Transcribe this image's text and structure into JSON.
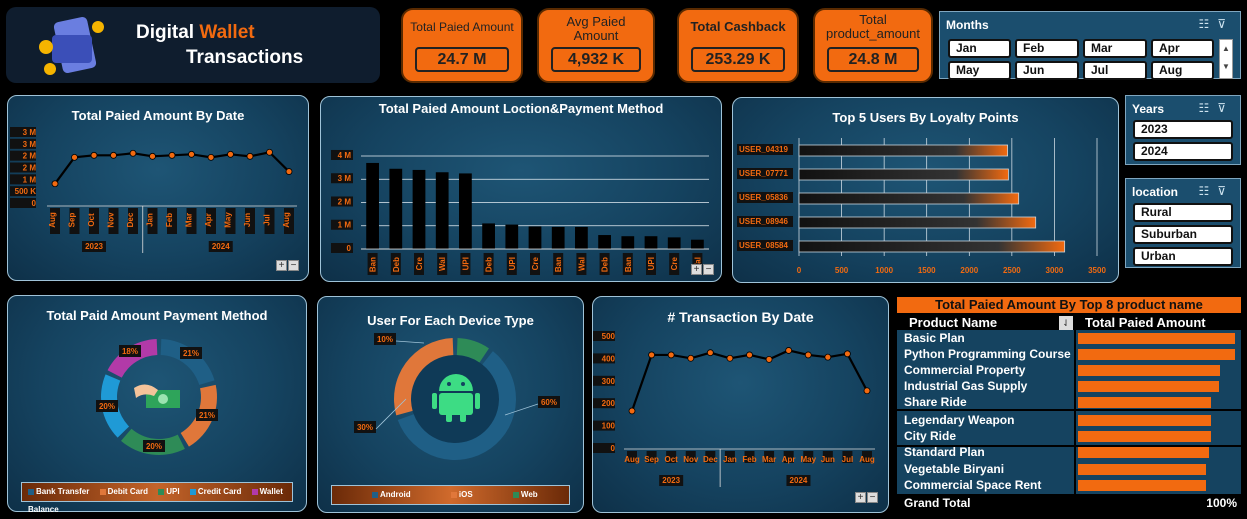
{
  "header": {
    "title_line1": "Digital",
    "title_accent": "Wallet",
    "title_line2": "Transactions"
  },
  "kpis": [
    {
      "label": "Total Paied Amount",
      "value": "24.7  M"
    },
    {
      "label": "Avg Paied Amount",
      "value": "4,932 K"
    },
    {
      "label": "Total Cashback",
      "value": "253.29 K"
    },
    {
      "label": "Total product_amount",
      "value": "24.8  M"
    }
  ],
  "slicers": {
    "months": {
      "title": "Months",
      "items": [
        "Jan",
        "Feb",
        "Mar",
        "Apr",
        "May",
        "Jun",
        "Jul",
        "Aug"
      ]
    },
    "years": {
      "title": "Years",
      "items": [
        "2023",
        "2024"
      ]
    },
    "location": {
      "title": "location",
      "items": [
        "Rural",
        "Suburban",
        "Urban"
      ]
    }
  },
  "colors": {
    "accent": "#f26a10",
    "panel": "#154360",
    "bank": "#1f5f86",
    "debit": "#e0773a",
    "upi": "#2e8b57",
    "credit": "#1f9ad6",
    "wallet": "#b23aa8"
  },
  "chart_data": [
    {
      "type": "line",
      "title": "Total Paied Amount By Date",
      "x": [
        "Aug",
        "Sep",
        "Oct",
        "Nov",
        "Dec",
        "Jan",
        "Feb",
        "Mar",
        "Apr",
        "May",
        "Jun",
        "Jul",
        "Aug"
      ],
      "groups": [
        {
          "label": "2023",
          "span": 5
        },
        {
          "label": "2024",
          "span": 8
        }
      ],
      "y_ticks": [
        "0",
        "500 K",
        "1 M",
        "2 M",
        "2 M",
        "3 M",
        "3 M"
      ],
      "values": [
        1.0,
        2.3,
        2.4,
        2.4,
        2.5,
        2.35,
        2.4,
        2.45,
        2.3,
        2.45,
        2.35,
        2.55,
        1.6
      ],
      "ylim": [
        0,
        3.5
      ]
    },
    {
      "type": "bar",
      "title": "Total Paied Amount Loction&Payment Method",
      "categories": [
        "Ban",
        "Deb",
        "Cre",
        "Wal",
        "UPI",
        "Deb",
        "UPI",
        "Cre",
        "Ban",
        "Wal",
        "Deb",
        "Ban",
        "UPI",
        "Cre",
        "Wal"
      ],
      "values": [
        3.7,
        3.45,
        3.4,
        3.3,
        3.25,
        1.1,
        1.05,
        0.97,
        0.95,
        0.95,
        0.6,
        0.55,
        0.55,
        0.5,
        0.4
      ],
      "y_ticks": [
        "0",
        "1 M",
        "2 M",
        "3 M",
        "4 M"
      ],
      "ylim": [
        0,
        4.3
      ]
    },
    {
      "type": "bar",
      "title": "Top 5 Users By Loyalty Points",
      "categories": [
        "USER_04319",
        "USER_07771",
        "USER_05836",
        "USER_08946",
        "USER_08584"
      ],
      "values": [
        2450,
        2460,
        2580,
        2780,
        3120
      ],
      "x_ticks": [
        "0",
        "500",
        "1000",
        "1500",
        "2000",
        "2500",
        "3000",
        "3500"
      ],
      "xlim": [
        0,
        3500
      ]
    },
    {
      "type": "pie",
      "title": "Total Paid Amount Payment Method",
      "slices": [
        {
          "name": "Bank Transfer",
          "value": 21,
          "label": "21%"
        },
        {
          "name": "Debit Card",
          "value": 21,
          "label": "21%"
        },
        {
          "name": "UPI",
          "value": 20,
          "label": "20%"
        },
        {
          "name": "Credit Card",
          "value": 20,
          "label": "20%"
        },
        {
          "name": "Wallet Balance",
          "value": 18,
          "label": "18%"
        }
      ]
    },
    {
      "type": "pie",
      "title": "User  For Each Device Type",
      "slices": [
        {
          "name": "Android",
          "value": 60,
          "label": "60%"
        },
        {
          "name": "iOS",
          "value": 30,
          "label": "30%"
        },
        {
          "name": "Web",
          "value": 10,
          "label": "10%"
        }
      ]
    },
    {
      "type": "line",
      "title": "# Transaction By Date",
      "x": [
        "Aug",
        "Sep",
        "Oct",
        "Nov",
        "Dec",
        "Jan",
        "Feb",
        "Mar",
        "Apr",
        "May",
        "Jun",
        "Jul",
        "Aug"
      ],
      "groups": [
        {
          "label": "2023",
          "span": 5
        },
        {
          "label": "2024",
          "span": 8
        }
      ],
      "y_ticks": [
        "0",
        "100",
        "200",
        "300",
        "400",
        "500"
      ],
      "values": [
        170,
        420,
        420,
        405,
        430,
        405,
        420,
        400,
        440,
        420,
        410,
        425,
        260
      ],
      "ylim": [
        0,
        500
      ]
    },
    {
      "type": "table",
      "title": "Total Paied Amount By Top 8  product name",
      "columns": [
        "Product Name",
        "Total Paied Amount"
      ],
      "rows": [
        {
          "name": "Basic Plan",
          "value": 0.98
        },
        {
          "name": "Python Programming Course",
          "value": 0.98
        },
        {
          "name": "Commercial Property",
          "value": 0.89
        },
        {
          "name": "Industrial Gas Supply",
          "value": 0.88
        },
        {
          "name": "Share Ride",
          "value": 0.83
        },
        {
          "name": "Legendary Weapon",
          "value": 0.83
        },
        {
          "name": "City Ride",
          "value": 0.83
        },
        {
          "name": "Standard Plan",
          "value": 0.82
        },
        {
          "name": "Vegetable Biryani",
          "value": 0.8
        },
        {
          "name": "Commercial Space Rent",
          "value": 0.8
        }
      ],
      "footer": {
        "label": "Grand Total",
        "value": "100%"
      }
    }
  ]
}
